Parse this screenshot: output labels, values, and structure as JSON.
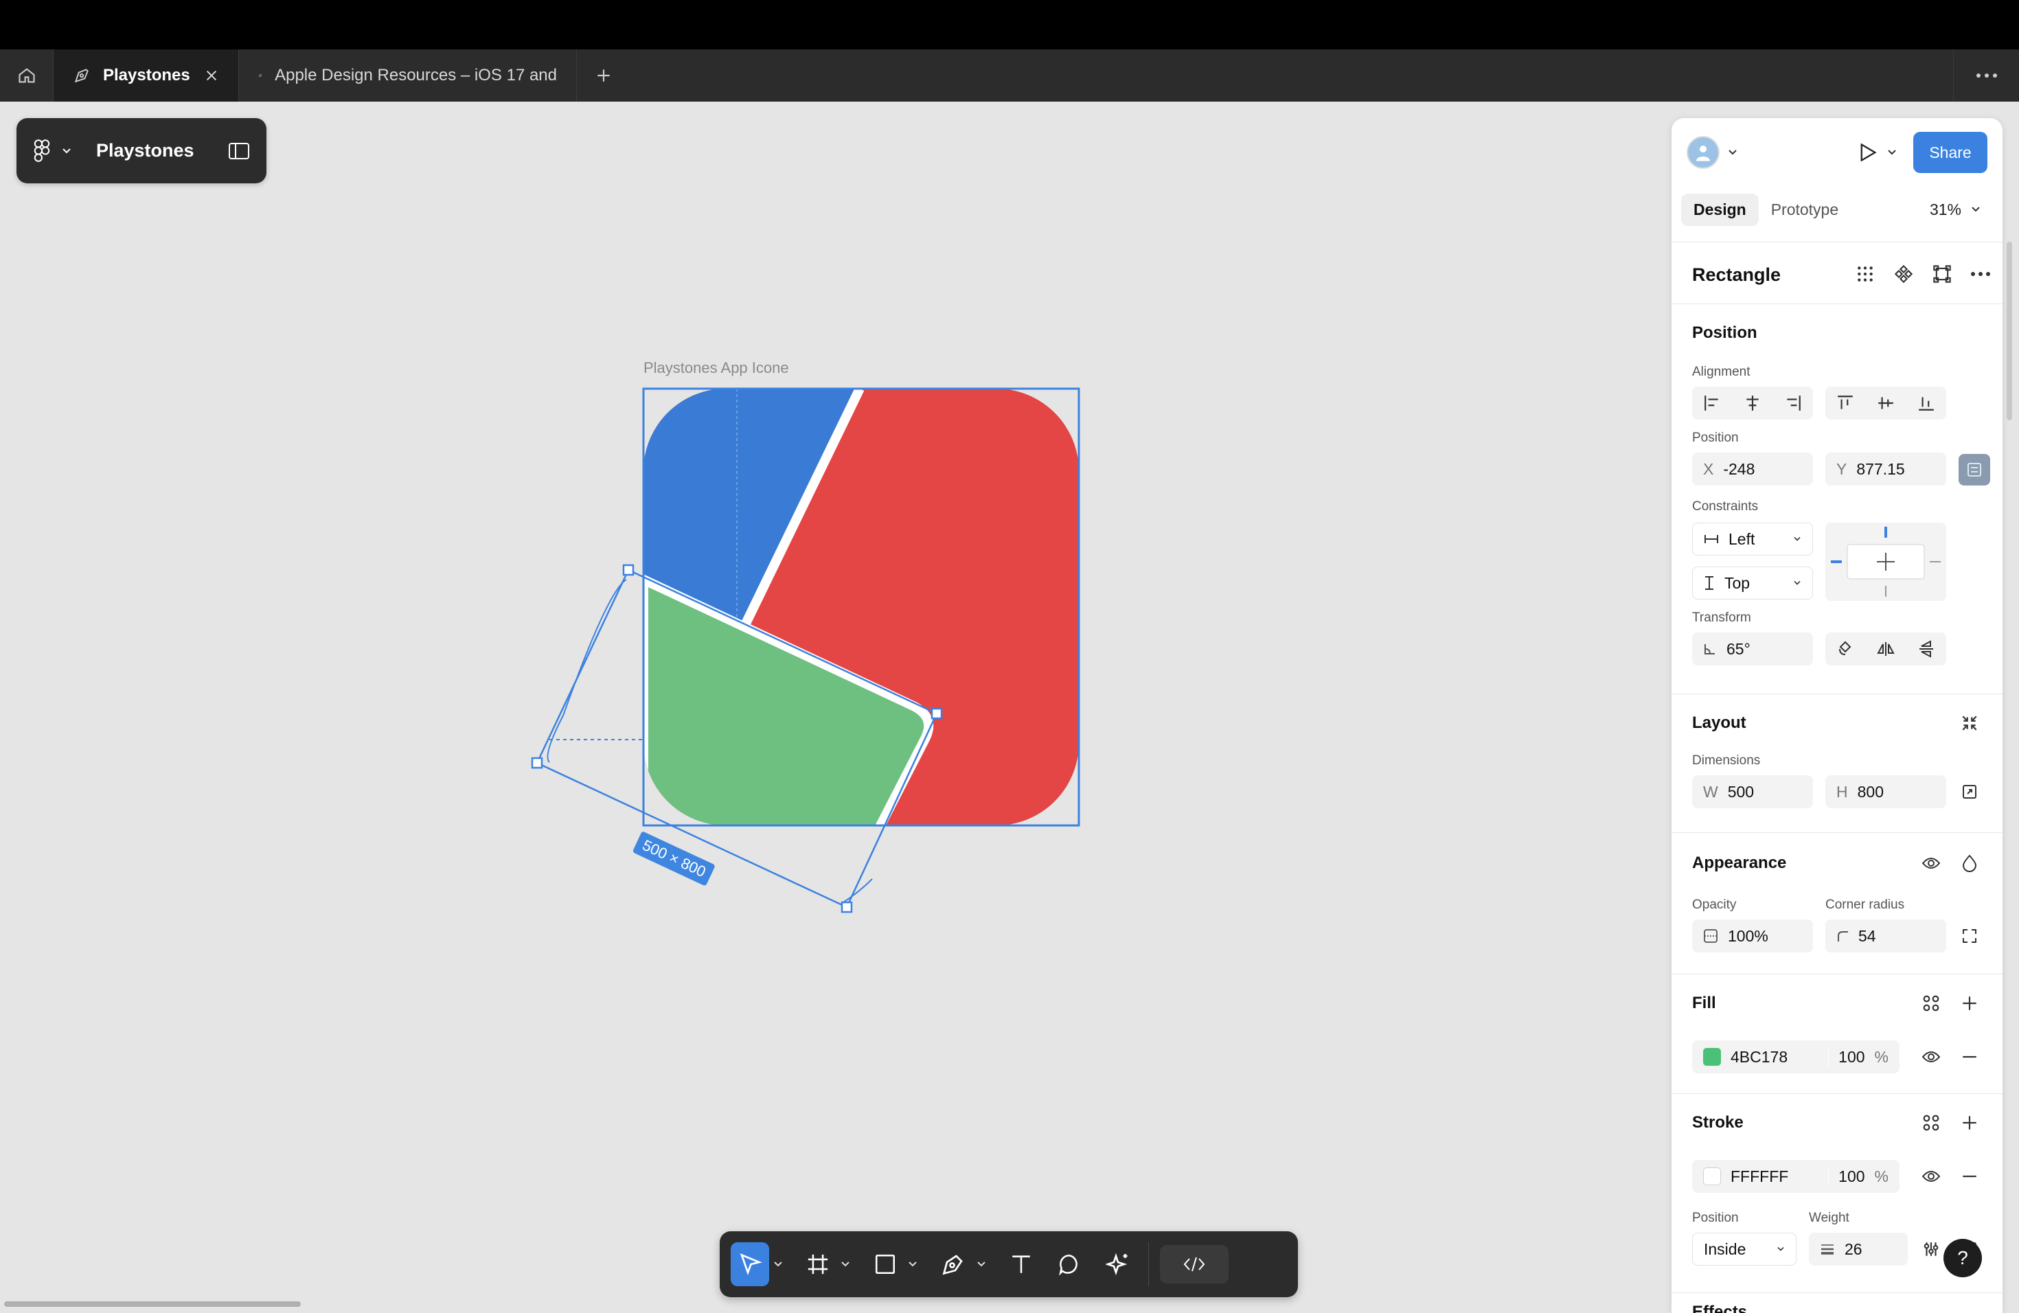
{
  "tabs": [
    {
      "label": "Playstones",
      "active": true
    },
    {
      "label": "Apple Design Resources – iOS 17 and",
      "active": false
    }
  ],
  "file": {
    "name": "Playstones"
  },
  "canvas": {
    "frame_label": "Playstones App Icone",
    "selection_size": "500 × 800",
    "colors": {
      "blue": "#3a7bd5",
      "red": "#e44545",
      "green": "#6dc07f",
      "selection": "#3b82e0"
    }
  },
  "panel": {
    "header": {
      "share_label": "Share"
    },
    "tabs": [
      "Design",
      "Prototype"
    ],
    "zoom": "31%",
    "selection_type": "Rectangle",
    "position": {
      "title": "Position",
      "alignment_label": "Alignment",
      "position_label": "Position",
      "x_prefix": "X",
      "x": "-248",
      "y_prefix": "Y",
      "y": "877.15",
      "constraints_label": "Constraints",
      "constraint_h": "Left",
      "constraint_v": "Top",
      "transform_label": "Transform",
      "rotation": "65°"
    },
    "layout": {
      "title": "Layout",
      "dimensions_label": "Dimensions",
      "w_prefix": "W",
      "w": "500",
      "h_prefix": "H",
      "h": "800"
    },
    "appearance": {
      "title": "Appearance",
      "opacity_label": "Opacity",
      "opacity": "100%",
      "radius_label": "Corner radius",
      "radius": "54"
    },
    "fill": {
      "title": "Fill",
      "hex": "4BC178",
      "opacity": "100",
      "unit": "%",
      "color": "#4bc178"
    },
    "stroke": {
      "title": "Stroke",
      "hex": "FFFFFF",
      "opacity": "100",
      "unit": "%",
      "color": "#ffffff",
      "position_label": "Position",
      "position": "Inside",
      "weight_label": "Weight",
      "weight": "26"
    },
    "effects": {
      "title": "Effects"
    }
  },
  "help_label": "?"
}
